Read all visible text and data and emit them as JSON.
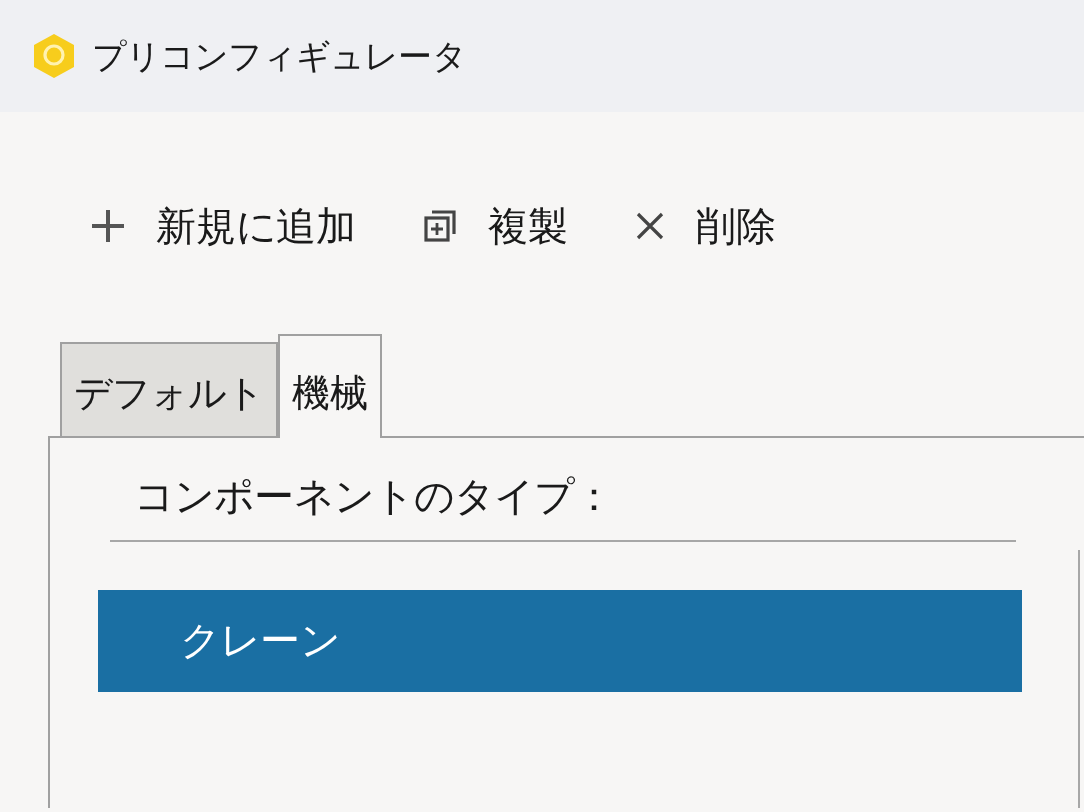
{
  "window": {
    "title": "プリコンフィギュレータ"
  },
  "toolbar": [
    {
      "kind": "add",
      "label": "新規に追加"
    },
    {
      "kind": "duplicate",
      "label": "複製"
    },
    {
      "kind": "delete",
      "label": "削除"
    }
  ],
  "tabs": [
    {
      "label": "デフォルト",
      "selected": false
    },
    {
      "label": "機械",
      "selected": true
    }
  ],
  "component_type": {
    "label": "コンポーネントのタイプ：",
    "items": [
      {
        "label": "クレーン",
        "selected": true
      }
    ]
  }
}
